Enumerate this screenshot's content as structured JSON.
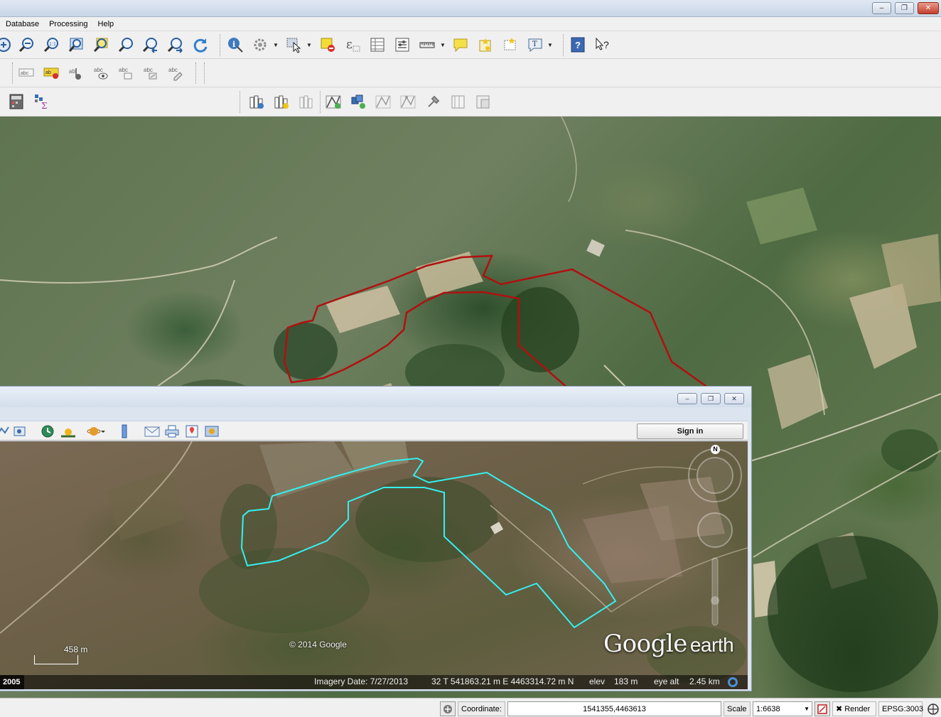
{
  "menubar": {
    "items": [
      "Database",
      "Processing",
      "Help"
    ]
  },
  "window_controls": {
    "minimize": "‒",
    "restore": "❐",
    "close": "✕"
  },
  "toolbar_label": {
    "text_tool": "T"
  },
  "toolbar_icons": {
    "row1": [
      "zoom-in-icon",
      "zoom-out-icon",
      "zoom-native-icon",
      "zoom-full-icon",
      "zoom-to-selection-icon",
      "zoom-to-layer-icon",
      "zoom-last-icon",
      "zoom-next-icon",
      "refresh-icon",
      "identify-icon",
      "action-icon",
      "select-icon",
      "deselect-icon",
      "expression-select-icon",
      "attribute-table-icon",
      "statistics-icon",
      "measure-icon",
      "map-tips-icon",
      "new-bookmark-icon",
      "show-bookmarks-icon",
      "text-annotation-icon",
      "help-icon",
      "whats-this-icon"
    ],
    "row2": [
      "label-icon",
      "label-highlight-icon",
      "pin-label-icon",
      "show-hide-label-icon",
      "move-label-icon",
      "rotate-label-icon",
      "change-label-icon"
    ],
    "row3": [
      "field-calculator-icon",
      "statistics-sum-icon",
      "add-layer-icon",
      "new-layer-icon",
      "remove-layer-icon",
      "toggle-edit-icon",
      "add-feature-icon",
      "move-feature-icon",
      "node-tool-icon",
      "delete-selected-icon",
      "cut-features-icon",
      "copy-features-icon"
    ]
  },
  "google_earth": {
    "window_controls": {
      "minimize": "‒",
      "restore": "❐",
      "close": "✕"
    },
    "sign_in_label": "Sign in",
    "copyright": "© 2014 Google",
    "logo_google": "Google",
    "logo_earth": "earth",
    "scale_label": "458 m",
    "year": "2005",
    "imagery_date": "Imagery Date: 7/27/2013",
    "coordinates": "32 T 541863.21 m E 4463314.72 m N",
    "elev_label": "elev",
    "elev_value": "183 m",
    "eye_alt_label": "eye alt",
    "eye_alt_value": "2.45 km",
    "compass_north": "N"
  },
  "statusbar": {
    "coordinate_label": "Coordinate:",
    "coordinate_value": "1541355,4463613",
    "scale_label": "Scale",
    "scale_value": "1:6638",
    "render_label": "Render",
    "render_checked_mark": "✖",
    "crs": "EPSG:3003"
  },
  "colors": {
    "qgis_polygon": "#b01010",
    "ge_polygon": "#35f0f0"
  }
}
